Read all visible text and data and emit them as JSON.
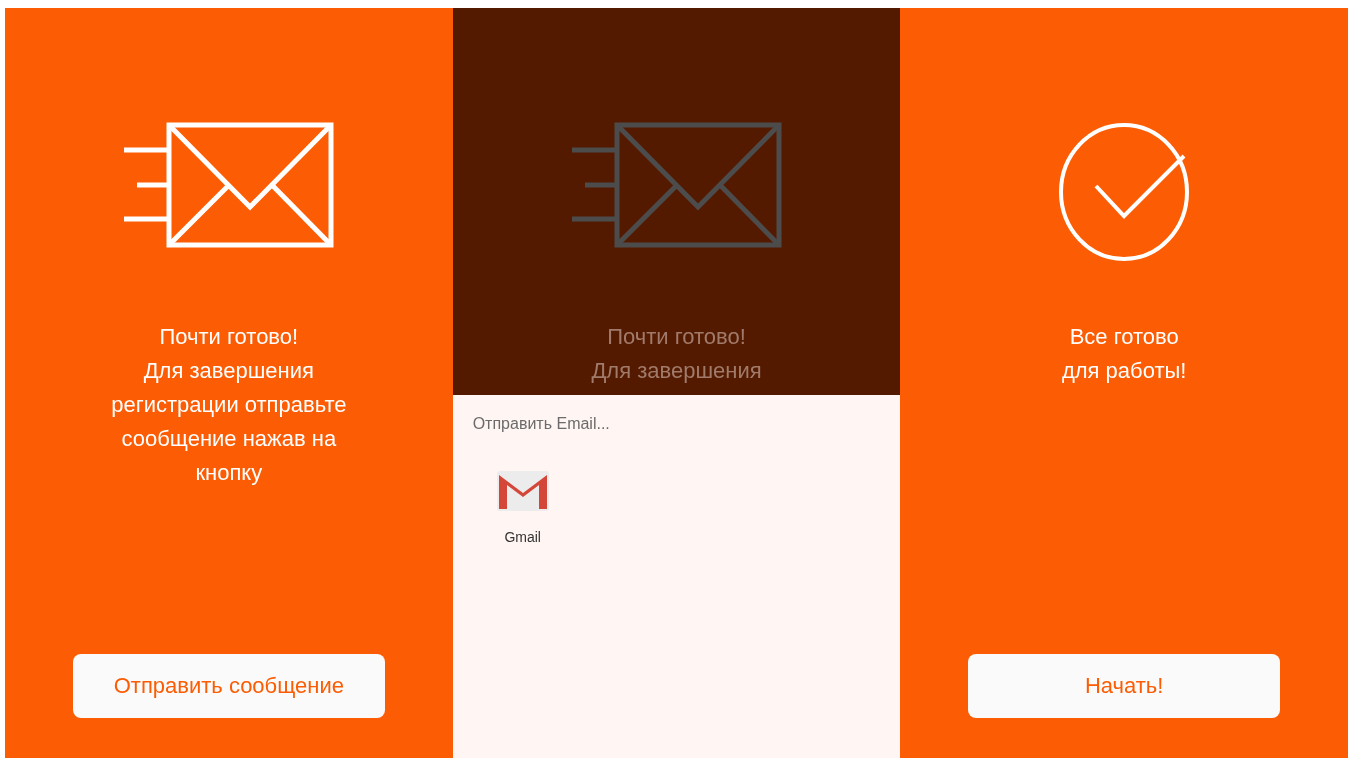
{
  "panels": [
    {
      "kind": "envelope",
      "dimmed": false,
      "lines": [
        "Почти готово!",
        "Для завершения",
        "регистрации отправьте",
        "сообщение нажав на",
        "кнопку"
      ],
      "button": "Отправить сообщение"
    },
    {
      "kind": "envelope",
      "dimmed": true,
      "lines": [
        "Почти готово!",
        "Для завершения"
      ],
      "sheet": {
        "title": "Отправить Email...",
        "apps": [
          {
            "label": "Gmail"
          }
        ]
      }
    },
    {
      "kind": "check",
      "dimmed": false,
      "lines": [
        "Все готово",
        "для работы!"
      ],
      "button": "Начать!"
    }
  ]
}
